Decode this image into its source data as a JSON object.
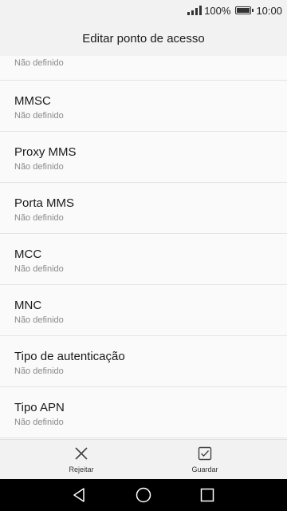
{
  "status_bar": {
    "battery_percent": "100%",
    "time": "10:00",
    "icons": [
      "signal-icon",
      "battery-icon"
    ]
  },
  "header": {
    "title": "Editar ponto de acesso"
  },
  "settings": {
    "partial_item": {
      "value": "Não definido"
    },
    "items": [
      {
        "label": "MMSC",
        "value": "Não definido"
      },
      {
        "label": "Proxy MMS",
        "value": "Não definido"
      },
      {
        "label": "Porta MMS",
        "value": "Não definido"
      },
      {
        "label": "MCC",
        "value": "Não definido"
      },
      {
        "label": "MNC",
        "value": "Não definido"
      },
      {
        "label": "Tipo de autenticação",
        "value": "Não definido"
      },
      {
        "label": "Tipo APN",
        "value": "Não definido"
      }
    ]
  },
  "actions": {
    "reject": {
      "label": "Rejeitar",
      "icon": "close-icon"
    },
    "save": {
      "label": "Guardar",
      "icon": "checkbox-icon"
    }
  },
  "nav": {
    "icons": [
      "back-icon",
      "home-icon",
      "recents-icon"
    ]
  }
}
